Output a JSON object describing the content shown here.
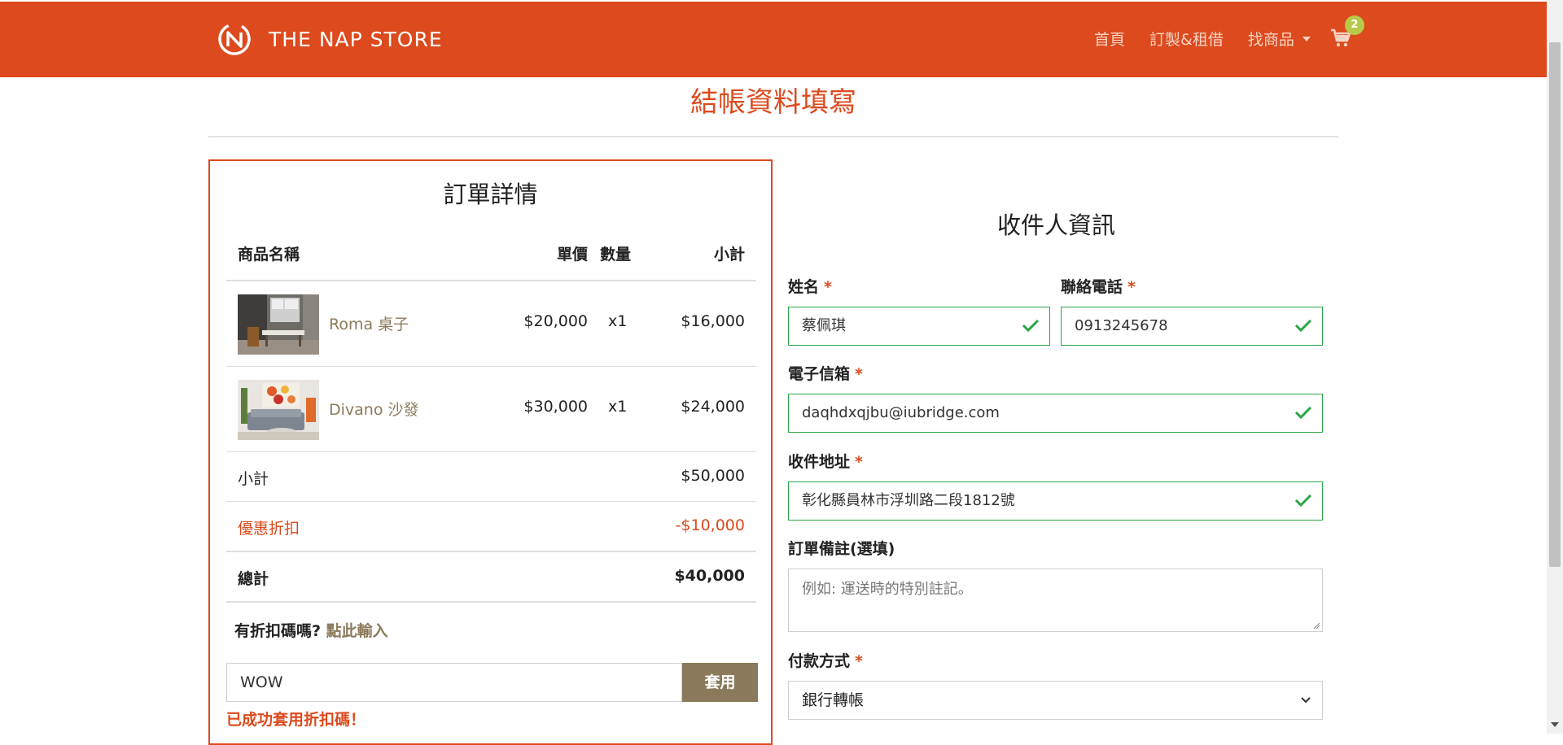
{
  "nav": {
    "brand": "THE NAP STORE",
    "links": [
      "首頁",
      "訂製&租借",
      "找商品"
    ],
    "cart_count": "2"
  },
  "page_title": "結帳資料填寫",
  "order": {
    "title": "訂單詳情",
    "headers": {
      "name": "商品名稱",
      "price": "單價",
      "qty": "數量",
      "subtotal": "小計"
    },
    "items": [
      {
        "name": "Roma 桌子",
        "price": "$20,000",
        "qty": "x1",
        "subtotal": "$16,000"
      },
      {
        "name": "Divano 沙發",
        "price": "$30,000",
        "qty": "x1",
        "subtotal": "$24,000"
      }
    ],
    "summary": {
      "subtotal_label": "小計",
      "subtotal_value": "$50,000",
      "discount_label": "優惠折扣",
      "discount_value": "-$10,000",
      "total_label": "總計",
      "total_value": "$40,000"
    },
    "coupon": {
      "question": "有折扣碼嗎?",
      "link": "點此輸入",
      "value": "WOW",
      "button": "套用",
      "message": "已成功套用折扣碼！"
    }
  },
  "recipient": {
    "title": "收件人資訊",
    "name_label": "姓名",
    "name_value": "蔡佩琪",
    "phone_label": "聯絡電話",
    "phone_value": "0913245678",
    "email_label": "電子信箱",
    "email_value": "daqhdxqjbu@iubridge.com",
    "address_label": "收件地址",
    "address_value": "彰化縣員林市浮圳路二段1812號",
    "note_label": "訂單備註(選填)",
    "note_placeholder": "例如: 運送時的特別註記。",
    "payment_label": "付款方式",
    "payment_value": "銀行轉帳",
    "required_mark": "*"
  },
  "colors": {
    "brand": "#dc4a1d",
    "accent": "#8a7a5b",
    "valid": "#28a745",
    "badge": "#b8c84a"
  }
}
